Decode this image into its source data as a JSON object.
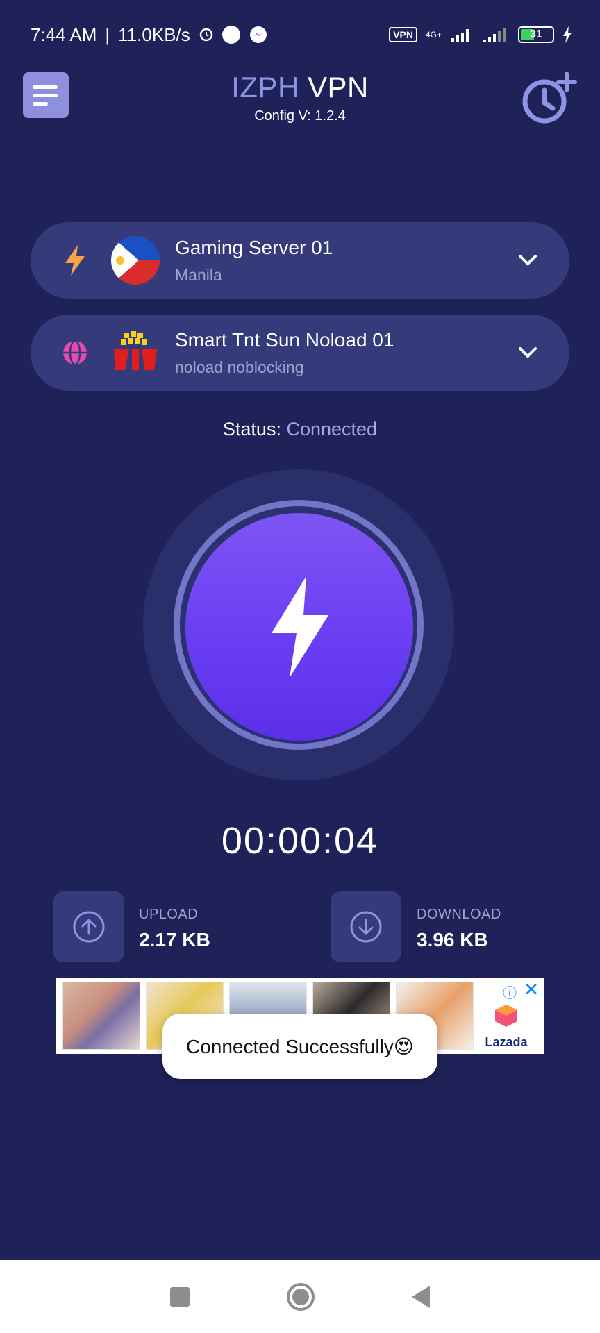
{
  "status_bar": {
    "time": "7:44 AM",
    "speed": "11.0KB/s",
    "vpn_badge": "VPN",
    "network": "4G+",
    "battery": "31"
  },
  "header": {
    "title_part1": "IZPH",
    "title_part2": "VPN",
    "config_version": "Config V: 1.2.4"
  },
  "servers": [
    {
      "name": "Gaming Server 01",
      "location": "Manila"
    },
    {
      "name": "Smart Tnt Sun Noload 01",
      "location": "noload noblocking"
    }
  ],
  "status": {
    "label": "Status:",
    "value": "Connected"
  },
  "elapsed": "00:00:04",
  "stats": {
    "upload_label": "UPLOAD",
    "upload_value": "2.17 KB",
    "download_label": "DOWNLOAD",
    "download_value": "3.96 KB"
  },
  "ad": {
    "brand": "Lazada"
  },
  "toast": "Connected Successfully😍",
  "colors": {
    "background": "#1f2259",
    "card": "#343a7a",
    "accent": "#8f93e3",
    "button": "#6a3ef2",
    "bolt": "#f5a447",
    "globe": "#e44bb0"
  }
}
